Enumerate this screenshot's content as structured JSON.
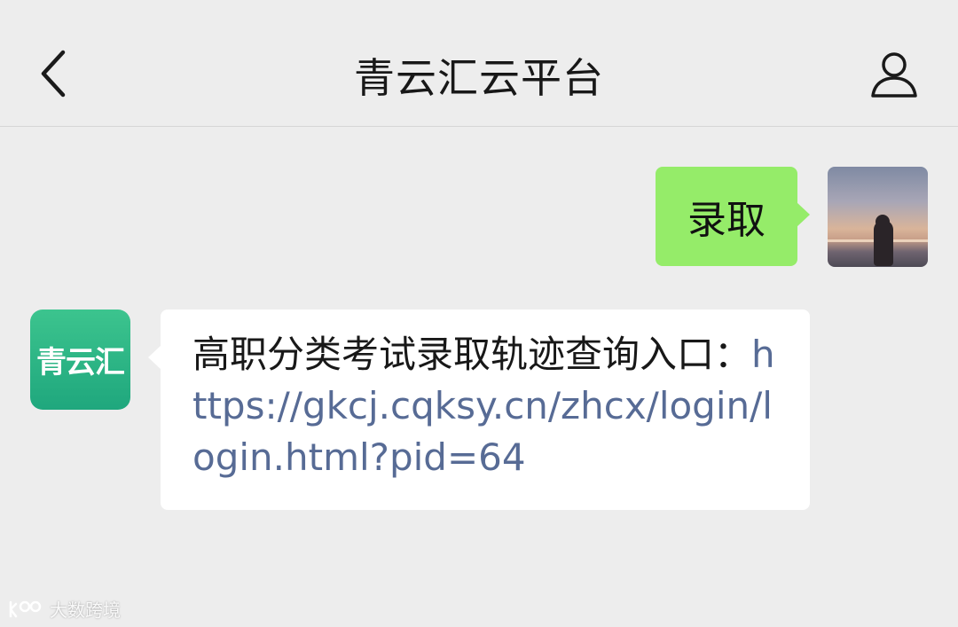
{
  "header": {
    "title": "青云汇云平台",
    "back_icon": "chevron-left-icon",
    "profile_icon": "person-icon"
  },
  "messages": {
    "outgoing": {
      "text": "录取",
      "bubble_color": "#95ec69"
    },
    "incoming": {
      "sender_avatar_text": "青云汇",
      "text_prefix": "高职分类考试录取轨迹查询入口：",
      "link": "https://gkcj.cqksy.cn/zhcx/login/login.html?pid=64",
      "link_color": "#576b95",
      "avatar_color": "#1fa77d"
    }
  },
  "watermark": {
    "text": "大数跨境"
  },
  "colors": {
    "background": "#ededed"
  }
}
